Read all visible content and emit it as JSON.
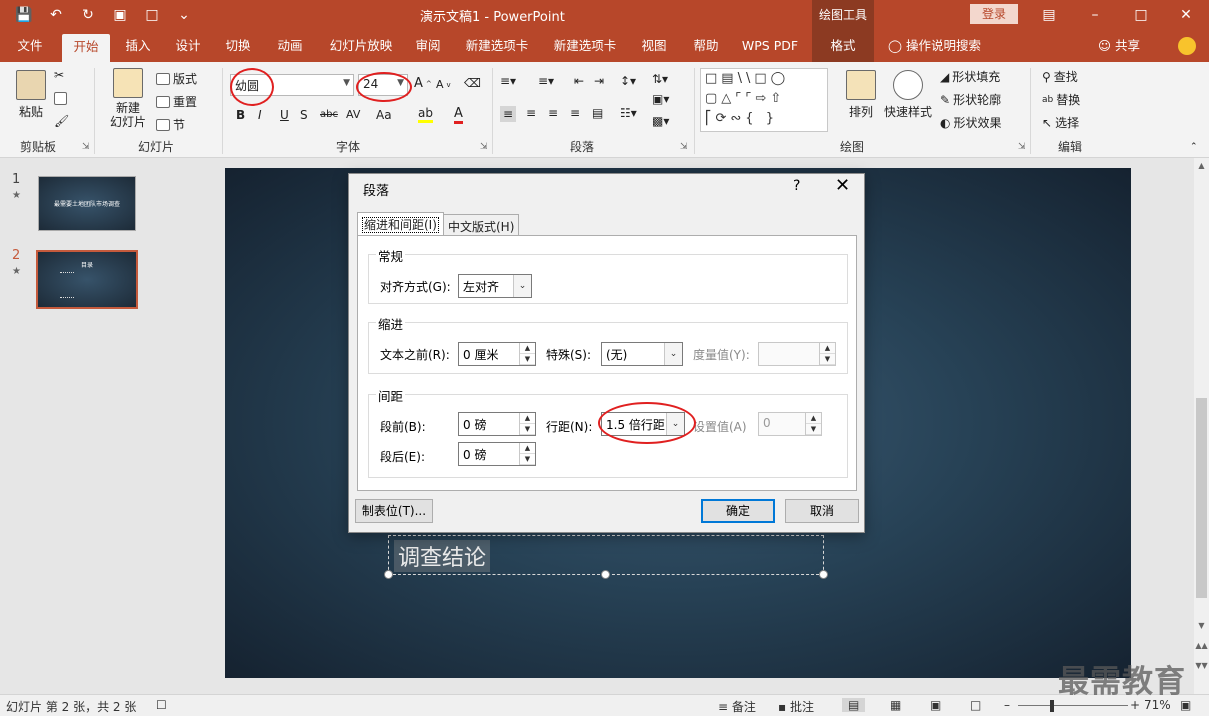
{
  "titlebar": {
    "doc_title": "演示文稿1  -  PowerPoint",
    "drawing_tools": "绘图工具",
    "login": "登录"
  },
  "tabs": [
    "文件",
    "开始",
    "插入",
    "设计",
    "切换",
    "动画",
    "幻灯片放映",
    "审阅",
    "新建选项卡",
    "新建选项卡",
    "视图",
    "帮助",
    "WPS PDF",
    "格式"
  ],
  "tell_me": "操作说明搜索",
  "share": "共享",
  "ribbon": {
    "clipboard": {
      "paste": "粘贴",
      "label": "剪贴板"
    },
    "slides": {
      "new_slide": "新建\n幻灯片",
      "layout": "版式",
      "reset": "重置",
      "section": "节",
      "label": "幻灯片"
    },
    "font": {
      "font_name": "幼圆",
      "font_size": "24",
      "label": "字体",
      "bold": "B",
      "italic": "I",
      "underline": "U",
      "shadow": "S",
      "strike": "abc",
      "spacing": "AV",
      "case": "Aa"
    },
    "paragraph": {
      "label": "段落"
    },
    "drawing": {
      "arrange": "排列",
      "quick_styles": "快速样式",
      "fill": "形状填充",
      "outline": "形状轮廓",
      "effects": "形状效果",
      "label": "绘图"
    },
    "editing": {
      "find": "查找",
      "replace": "替换",
      "select": "选择",
      "label": "编辑"
    }
  },
  "slides_panel": [
    {
      "num": "1",
      "title": "最需要土地团队市场调查"
    },
    {
      "num": "2",
      "title": "目录"
    }
  ],
  "slide": {
    "text": "调查结论"
  },
  "dialog": {
    "title": "段落",
    "help": "?",
    "tabs": [
      "缩进和间距(I)",
      "中文版式(H)"
    ],
    "general": {
      "legend": "常规",
      "align_label": "对齐方式(G):",
      "align_value": "左对齐"
    },
    "indent": {
      "legend": "缩进",
      "before_label": "文本之前(R):",
      "before_value": "0 厘米",
      "special_label": "特殊(S):",
      "special_value": "(无)",
      "by_label": "度量值(Y):",
      "by_value": ""
    },
    "spacing": {
      "legend": "间距",
      "before_label": "段前(B):",
      "before_value": "0 磅",
      "after_label": "段后(E):",
      "after_value": "0 磅",
      "line_label": "行距(N):",
      "line_value": "1.5 倍行距",
      "at_label": "设置值(A)",
      "at_value": "0"
    },
    "tabs_button": "制表位(T)...",
    "ok": "确定",
    "cancel": "取消"
  },
  "status": {
    "slide_info": "幻灯片 第 2 张，共 2 张",
    "notes": "备注",
    "comments": "批注",
    "zoom": "71%"
  },
  "watermark": "最需教育",
  "colors": {
    "accent": "#b7472a",
    "dialog_focus": "#0078d7",
    "annotation": "#e02020"
  }
}
